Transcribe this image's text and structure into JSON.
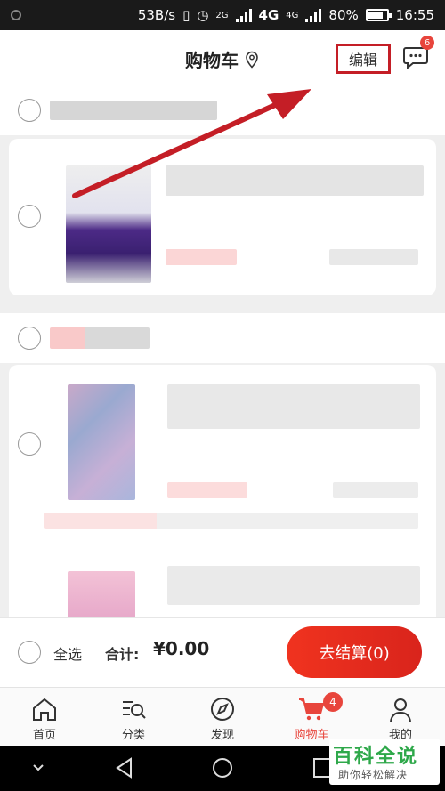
{
  "status_bar": {
    "speed": "53B/s",
    "network_a": "2G",
    "network_b": "4G",
    "network_c": "4G",
    "battery": "80%",
    "battery_level": 0.8,
    "time": "16:55"
  },
  "header": {
    "title": "购物车",
    "location_icon": "location-pin-icon",
    "edit_label": "编辑",
    "message_badge": "6"
  },
  "checkout": {
    "select_all_label": "全选",
    "total_label": "合计:",
    "total_value": "¥0.00",
    "checkout_button_label": "去结算(0)"
  },
  "tabs": [
    {
      "label": "首页",
      "icon": "home-icon"
    },
    {
      "label": "分类",
      "icon": "category-search-icon"
    },
    {
      "label": "发现",
      "icon": "compass-icon"
    },
    {
      "label": "购物车",
      "icon": "cart-icon",
      "badge": "4",
      "active": true
    },
    {
      "label": "我的",
      "icon": "user-icon"
    }
  ],
  "watermark": {
    "title": "百科全说",
    "subtitle": "助你轻松解决"
  },
  "colors": {
    "accent": "#e8453c",
    "annotation_red": "#c41e26"
  }
}
